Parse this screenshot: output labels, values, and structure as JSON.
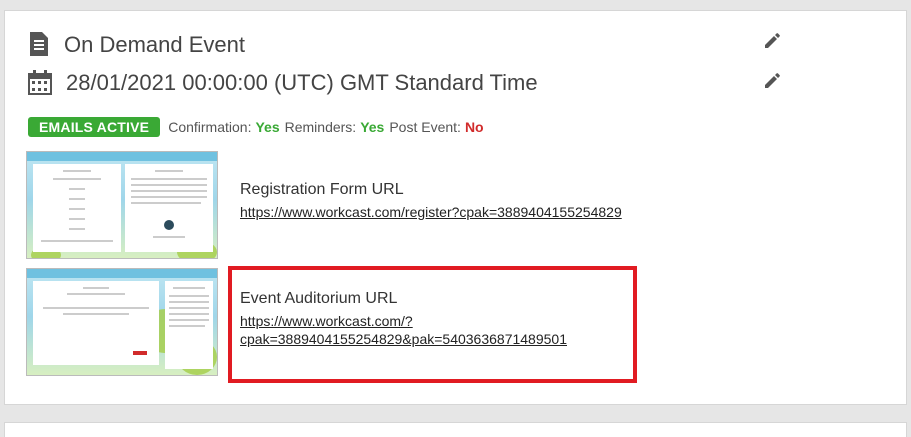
{
  "event": {
    "title": "On Demand Event",
    "date": "28/01/2021 00:00:00 (UTC) GMT Standard Time"
  },
  "status": {
    "badge": "EMAILS ACTIVE",
    "confirmation_label": "Confirmation:",
    "confirmation_value": "Yes",
    "reminders_label": "Reminders:",
    "reminders_value": "Yes",
    "post_event_label": "Post Event:",
    "post_event_value": "No"
  },
  "links": [
    {
      "title": "Registration Form URL",
      "url_line1": "https://www.workcast.com/register?cpak=3889404155254829",
      "url_line2": ""
    },
    {
      "title": "Event Auditorium URL",
      "url_line1": "https://www.workcast.com/?",
      "url_line2": "cpak=3889404155254829&pak=5403636871489501"
    }
  ],
  "colors": {
    "active_green": "#3aa935",
    "no_red": "#d12b2b",
    "highlight_red": "#e11b22"
  },
  "icons": {
    "title": "document-icon",
    "date": "calendar-icon",
    "edit": "pencil-icon"
  }
}
